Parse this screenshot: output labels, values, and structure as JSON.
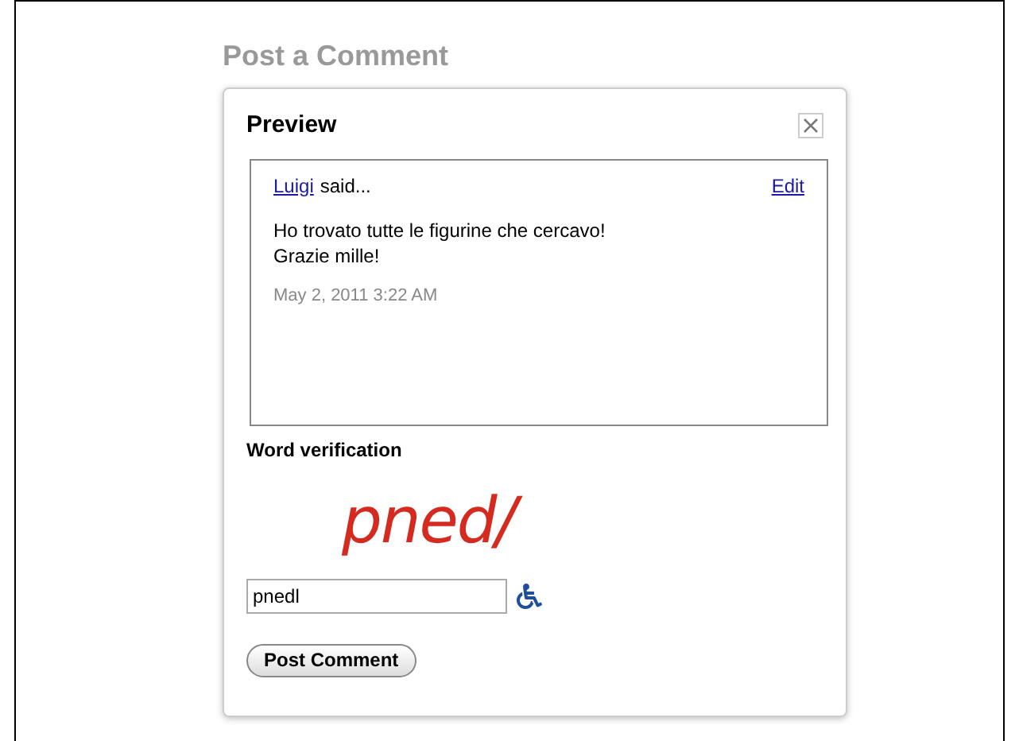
{
  "heading": "Post a Comment",
  "dialog": {
    "title": "Preview",
    "comment": {
      "author": "Luigi",
      "said": "said...",
      "edit": "Edit",
      "lines": [
        "Ho trovato tutte le figurine che cercavo!",
        "Grazie mille!"
      ],
      "timestamp": "May 2, 2011 3:22 AM"
    },
    "verification": {
      "label": "Word verification",
      "captcha": "pned/",
      "value": "pnedl"
    },
    "submit": "Post Comment"
  }
}
